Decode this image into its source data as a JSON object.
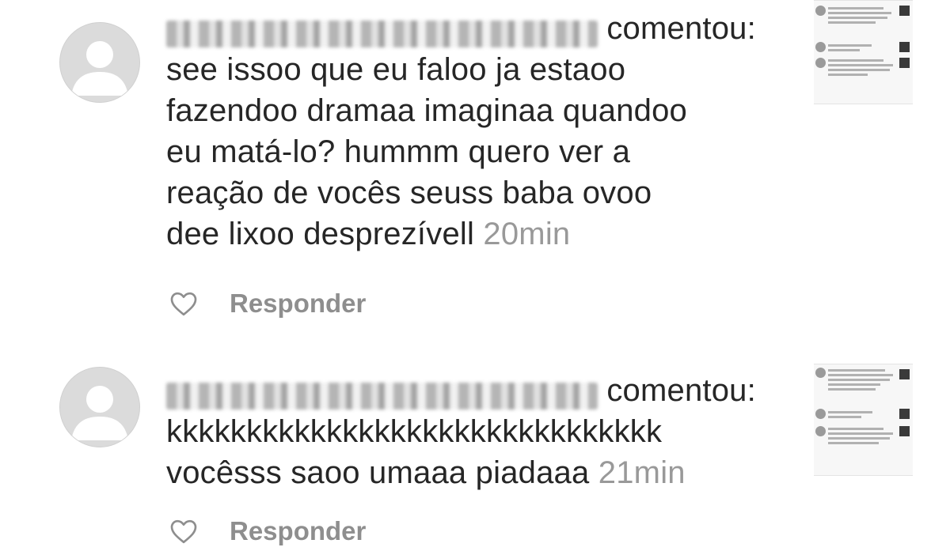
{
  "notifications": [
    {
      "username": "████████████",
      "action": "comentou:",
      "text_lines": [
        "see issoo que eu faloo ja estaoo",
        "fazendoo dramaa imaginaa quandoo",
        "eu matá-lo? hummm quero ver a",
        "reação de vocês seuss baba ovoo",
        "dee lixoo desprezívell"
      ],
      "time": "20min",
      "reply_label": "Responder",
      "like_icon": "heart-outline-icon"
    },
    {
      "username": "████████████",
      "action": "comentou:",
      "text_lines": [
        "kkkkkkkkkkkkkkkkkkkkkkkkkkkkkkk",
        "vocêsss saoo umaaa piadaaa"
      ],
      "time": "21min",
      "reply_label": "Responder",
      "like_icon": "heart-outline-icon"
    }
  ],
  "colors": {
    "text": "#262626",
    "muted": "#999999",
    "reply": "#8e8e8e",
    "avatar": "#dbdbdb"
  }
}
